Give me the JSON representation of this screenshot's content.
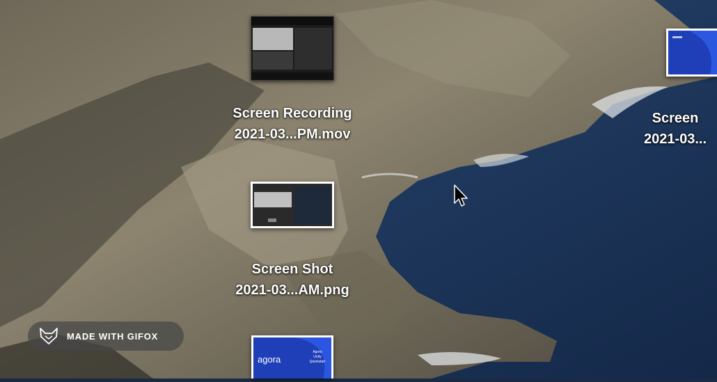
{
  "desktop": {
    "icons": [
      {
        "line1": "Screen Recording",
        "line2": "2021-03...PM.mov",
        "kind": "movie"
      },
      {
        "line1": "Screen Shot",
        "line2": "2021-03...AM.png",
        "kind": "screenshot"
      },
      {
        "line1": "Screen",
        "line2": "2021-03...",
        "kind": "screenshot-blue"
      },
      {
        "line1": "",
        "line2": "",
        "kind": "screenshot-blue"
      }
    ],
    "thumb_texts": {
      "agora_logo": "agora",
      "agora_title": "Agora Unity Quickstart"
    }
  },
  "watermark": {
    "text": "MADE WITH GIFOX",
    "icon": "fox-icon"
  },
  "cursor": {
    "icon": "arrow-cursor-icon"
  },
  "colors": {
    "sea": "#1d3558",
    "rock": "#8a826f",
    "foam": "#e8ecef",
    "agora_blue": "#1f3fb8"
  }
}
